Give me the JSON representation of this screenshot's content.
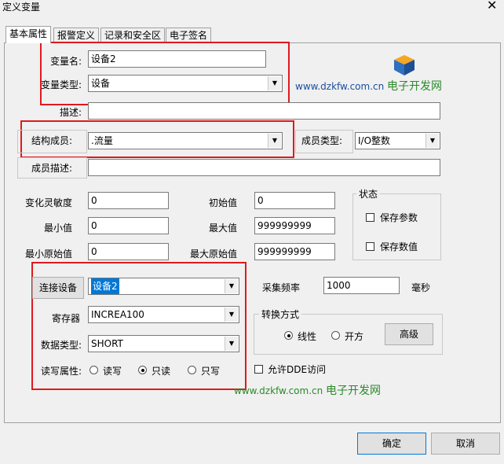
{
  "window": {
    "title": "定义变量",
    "close_glyph": "✕"
  },
  "tabs": [
    "基本属性",
    "报警定义",
    "记录和安全区",
    "电子签名"
  ],
  "basic": {
    "var_name_label": "变量名:",
    "var_name_value": "设备2",
    "var_type_label": "变量类型:",
    "var_type_value": "设备",
    "desc_label": "描述:",
    "desc_value": "",
    "struct_member_label": "结构成员:",
    "struct_member_value": ".流量",
    "member_type_label": "成员类型:",
    "member_type_value": "I/O整数",
    "member_desc_label": "成员描述:",
    "member_desc_value": ""
  },
  "numbers": {
    "sensitivity_label": "变化灵敏度",
    "sensitivity_value": "0",
    "min_label": "最小值",
    "min_value": "0",
    "min_raw_label": "最小原始值",
    "min_raw_value": "0",
    "init_label": "初始值",
    "init_value": "0",
    "max_label": "最大值",
    "max_value": "999999999",
    "max_raw_label": "最大原始值",
    "max_raw_value": "999999999"
  },
  "status": {
    "group_label": "状态",
    "save_params_label": "保存参数",
    "save_values_label": "保存数值"
  },
  "io": {
    "connect_button": "连接设备",
    "device_value": "设备2",
    "register_label": "寄存器",
    "register_value": "INCREA100",
    "data_type_label": "数据类型:",
    "data_type_value": "SHORT",
    "rw_label": "读写属性:",
    "rw_options": [
      "读写",
      "只读",
      "只写"
    ],
    "rw_selected": "只读"
  },
  "sampling": {
    "label": "采集频率",
    "value": "1000",
    "unit": "毫秒"
  },
  "convert": {
    "group_label": "转换方式",
    "linear_label": "线性",
    "sqrt_label": "开方",
    "advanced_button": "高级",
    "selected": "线性"
  },
  "dde": {
    "label": "允许DDE访问"
  },
  "watermark": {
    "site": "www.dzkfw.com.cn",
    "name": "电子开发网"
  },
  "footer": {
    "ok_label": "确定",
    "cancel_label": "取消"
  },
  "colors": {
    "highlight_box": "#e0191e",
    "selection": "#0078d7"
  },
  "icons": {
    "logo": "cube-logo-icon",
    "dropdown": "chevron-down-icon"
  }
}
